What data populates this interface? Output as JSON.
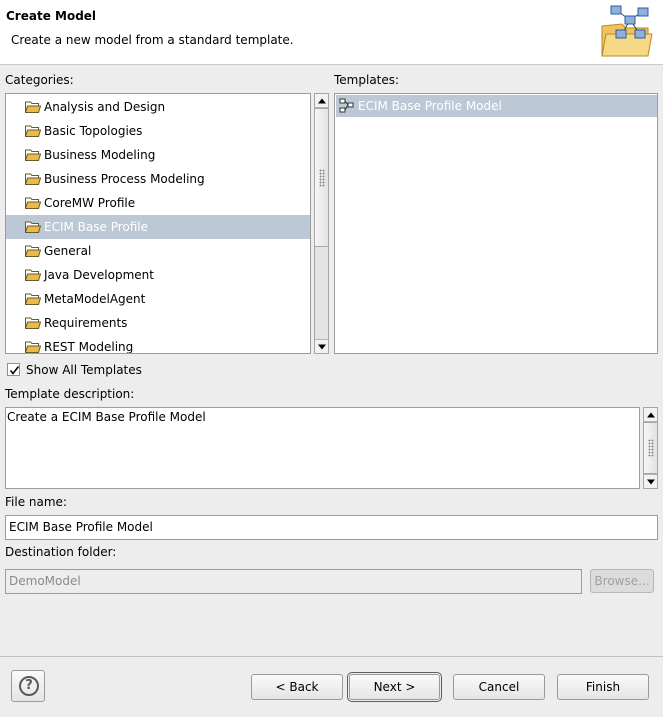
{
  "header": {
    "title": "Create Model",
    "subtitle": "Create a new model from a standard template."
  },
  "categories": {
    "label": "Categories:",
    "items": [
      {
        "label": "Analysis and Design",
        "selected": false
      },
      {
        "label": "Basic Topologies",
        "selected": false
      },
      {
        "label": "Business Modeling",
        "selected": false
      },
      {
        "label": "Business Process Modeling",
        "selected": false
      },
      {
        "label": "CoreMW Profile",
        "selected": false
      },
      {
        "label": "ECIM Base Profile",
        "selected": true
      },
      {
        "label": "General",
        "selected": false
      },
      {
        "label": "Java Development",
        "selected": false
      },
      {
        "label": "MetaModelAgent",
        "selected": false
      },
      {
        "label": "Requirements",
        "selected": false
      },
      {
        "label": "REST Modeling",
        "selected": false
      }
    ]
  },
  "templates": {
    "label": "Templates:",
    "items": [
      {
        "label": "ECIM Base Profile Model",
        "selected": true
      }
    ]
  },
  "show_all": {
    "label": "Show All Templates",
    "checked": true
  },
  "description": {
    "label": "Template description:",
    "text": "Create a ECIM Base Profile Model"
  },
  "file_name": {
    "label": "File name:",
    "value": "ECIM Base Profile Model"
  },
  "destination": {
    "label": "Destination folder:",
    "value": "DemoModel",
    "browse_label": "Browse..."
  },
  "footer": {
    "help_icon": "help-icon",
    "back_label": "< Back",
    "next_label": "Next >",
    "cancel_label": "Cancel",
    "finish_label": "Finish"
  },
  "colors": {
    "selection": "#bcc8d6",
    "folder": "#e9b949"
  }
}
